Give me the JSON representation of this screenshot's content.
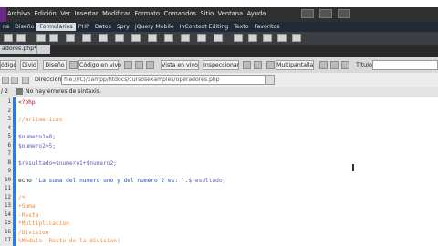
{
  "menu": [
    "Archivo",
    "Edición",
    "Ver",
    "Insertar",
    "Modificar",
    "Formato",
    "Comandos",
    "Sitio",
    "Ventana",
    "Ayuda"
  ],
  "toolbar_tabs": [
    {
      "label": "ns",
      "active": false
    },
    {
      "label": "Diseño",
      "active": false
    },
    {
      "label": "Formularios",
      "active": true
    },
    {
      "label": "PHP",
      "active": false
    },
    {
      "label": "Datos",
      "active": false
    },
    {
      "label": "Spry",
      "active": false
    },
    {
      "label": "jQuery Mobile",
      "active": false
    },
    {
      "label": "InContext Editing",
      "active": false
    },
    {
      "label": "Texto",
      "active": false
    },
    {
      "label": "Favoritos",
      "active": false
    }
  ],
  "document_tab": "adores.php*",
  "view_buttons": {
    "code": "ódigo",
    "split": "Divid",
    "design": "Diseño",
    "live_code": "Código en vivo",
    "live_view": "Vista en vivo",
    "inspect": "Inspeccionar",
    "fullscreen": "Multipantalla"
  },
  "title_label": "Título:",
  "address": {
    "label": "Dirección:",
    "value": "file:///C|/xampp/htdocs/cursosexamples/operadores.php"
  },
  "status": {
    "count": "/ 2",
    "message": "No hay errores de sintaxis."
  },
  "code_lines": [
    {
      "n": "1",
      "segs": [
        {
          "t": "<?php",
          "c": "c-tag"
        }
      ]
    },
    {
      "n": "2",
      "segs": []
    },
    {
      "n": "3",
      "segs": [
        {
          "t": "//aritmeticos",
          "c": "c-com"
        }
      ]
    },
    {
      "n": "4",
      "segs": []
    },
    {
      "n": "5",
      "segs": [
        {
          "t": "$numero1=8;",
          "c": "c-var"
        }
      ]
    },
    {
      "n": "6",
      "segs": [
        {
          "t": "$numero2=5;",
          "c": "c-var"
        }
      ]
    },
    {
      "n": "7",
      "segs": []
    },
    {
      "n": "8",
      "segs": [
        {
          "t": "$resultado=$numero1+$numero2;",
          "c": "c-var"
        }
      ]
    },
    {
      "n": "9",
      "segs": []
    },
    {
      "n": "10",
      "segs": [
        {
          "t": "echo ",
          "c": "c-kw"
        },
        {
          "t": "'La suma del numero uno y del numero 2 es: '",
          "c": "c-str"
        },
        {
          "t": ".$resultado;",
          "c": "c-vs"
        }
      ]
    },
    {
      "n": "11",
      "segs": []
    },
    {
      "n": "12",
      "segs": [
        {
          "t": "/*",
          "c": "c-com"
        }
      ]
    },
    {
      "n": "13",
      "segs": [
        {
          "t": "+Suma",
          "c": "c-com"
        }
      ]
    },
    {
      "n": "14",
      "segs": [
        {
          "t": "-Resta",
          "c": "c-com"
        }
      ]
    },
    {
      "n": "15",
      "segs": [
        {
          "t": "*Multiplicacion",
          "c": "c-com"
        }
      ]
    },
    {
      "n": "16",
      "segs": [
        {
          "t": "/Division",
          "c": "c-com"
        }
      ]
    },
    {
      "n": "17",
      "segs": [
        {
          "t": "%Modulo (Resto de la division)",
          "c": "c-com"
        }
      ]
    }
  ]
}
